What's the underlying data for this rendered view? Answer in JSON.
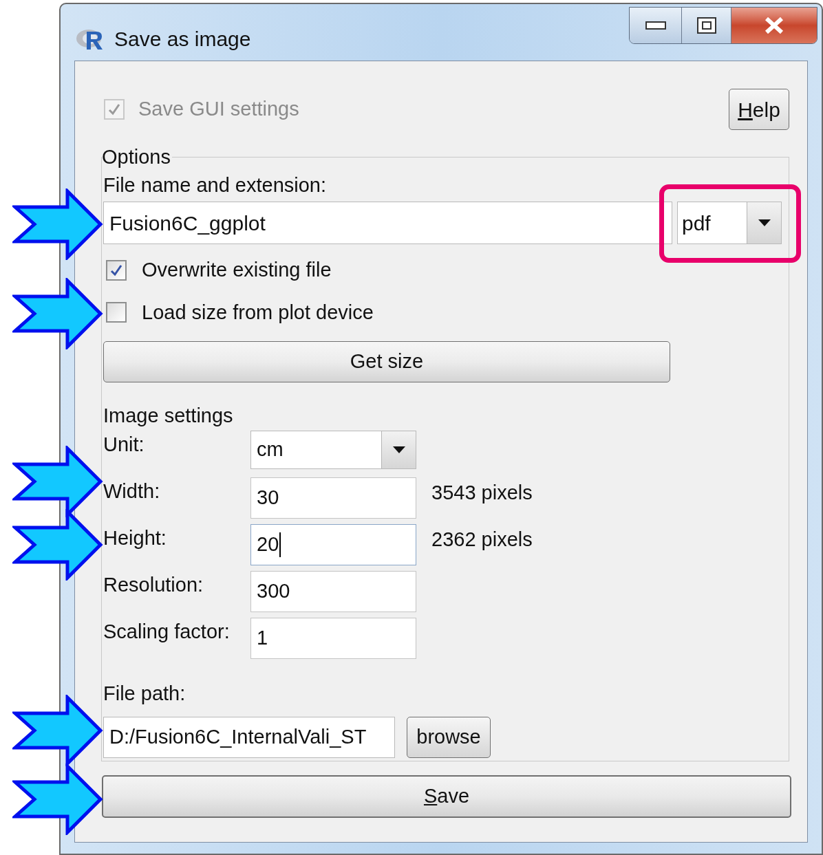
{
  "window": {
    "title": "Save as image"
  },
  "save_gui_settings": {
    "label": "Save GUI settings",
    "checked": true,
    "disabled": true
  },
  "help_button": {
    "label": "Help",
    "access_key_underlined": true
  },
  "options": {
    "legend": "Options",
    "file_name_label": "File name and extension:",
    "file_name": "Fusion6C_ggplot",
    "format": "pdf",
    "checkboxes": [
      {
        "label": "Overwrite existing file",
        "checked": true
      },
      {
        "label": "Load size from plot device",
        "checked": false
      }
    ],
    "get_size_button": "Get size",
    "image_settings_heading": "Image settings",
    "fields": [
      {
        "kind": "dropdown",
        "label": "Unit:",
        "value": "cm"
      },
      {
        "kind": "text",
        "label": "Width:",
        "value": "30",
        "note": "3543 pixels",
        "focused": false
      },
      {
        "kind": "text",
        "label": "Height:",
        "value": "20",
        "note": "2362 pixels",
        "focused": true
      },
      {
        "kind": "text",
        "label": "Resolution:",
        "value": "300",
        "focused": false
      },
      {
        "kind": "text",
        "label": "Scaling factor:",
        "value": "1",
        "focused": false
      }
    ],
    "file_path_label": "File path:",
    "file_path": "D:/Fusion6C_InternalVali_ST",
    "browse_button": "browse"
  },
  "save_button": {
    "label": "Save",
    "access_key_underlined": true
  }
}
